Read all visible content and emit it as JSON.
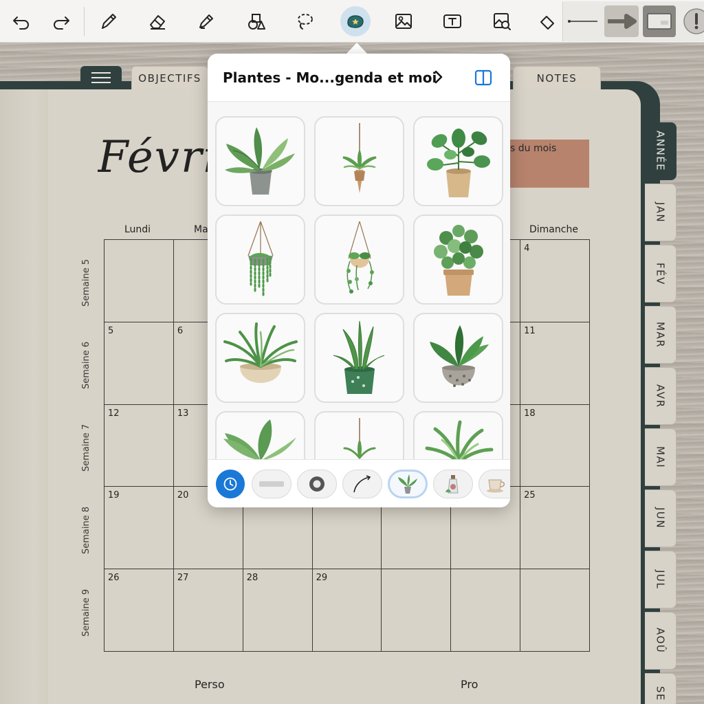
{
  "toolbar": {
    "tools": [
      "undo-icon",
      "redo-icon",
      "pen-icon",
      "eraser-icon",
      "highlighter-icon",
      "shapes-icon",
      "lasso-icon",
      "sticker-icon",
      "image-icon",
      "text-icon",
      "image-search-icon",
      "ruler-icon"
    ],
    "active_tool": "sticker-icon",
    "accent": "#1a78d7"
  },
  "planner": {
    "top_tabs": [
      "OBJECTIFS",
      "NOTES"
    ],
    "month_title": "Févri",
    "month_priorities": "s du mois",
    "days": {
      "first": "Lundi",
      "second": "Ma",
      "last": "Dimanche"
    },
    "weeks": [
      "Semaine 5",
      "Semaine 6",
      "Semaine 7",
      "Semaine 8",
      "Semaine 9"
    ],
    "rows": [
      [
        "",
        "",
        "",
        "",
        "",
        "",
        "4"
      ],
      [
        "5",
        "6",
        "",
        "",
        "",
        "",
        "11"
      ],
      [
        "12",
        "13",
        "",
        "",
        "",
        "",
        "18"
      ],
      [
        "19",
        "20",
        "",
        "",
        "",
        "",
        "25"
      ],
      [
        "26",
        "27",
        "28",
        "29",
        "",
        "",
        ""
      ]
    ],
    "footer": {
      "left": "Perso",
      "right": "Pro"
    },
    "side_tabs": [
      "ANNÉE",
      "JAN",
      "FÉV",
      "MAR",
      "AVR",
      "MAI",
      "JUN",
      "JUL",
      "AOÛ",
      "SE"
    ],
    "active_side_tab": "ANNÉE",
    "colors": {
      "dark": "#2f403f",
      "paper": "#d8d3c8",
      "terracotta": "#b7836d"
    }
  },
  "sticker_popover": {
    "title": "Plantes - Mo...genda et moi",
    "stickers": [
      "potted-plant-sticker",
      "hanging-plant-sticker",
      "potted-pothos-sticker",
      "hanging-string-plant-sticker",
      "hanging-ivy-sticker",
      "potted-pilea-sticker",
      "spider-plant-sticker",
      "snake-plant-sticker",
      "potted-fiddle-sticker",
      "leafy-plant-sticker",
      "hanging-small-plant-sticker",
      "grass-plant-sticker"
    ],
    "categories": [
      "recent-icon",
      "washi-tape-icon",
      "tape-roll-icon",
      "arrow-icon",
      "plant-icon",
      "bottle-icon",
      "coffee-cup-icon"
    ],
    "selected_category": "plant-icon"
  }
}
